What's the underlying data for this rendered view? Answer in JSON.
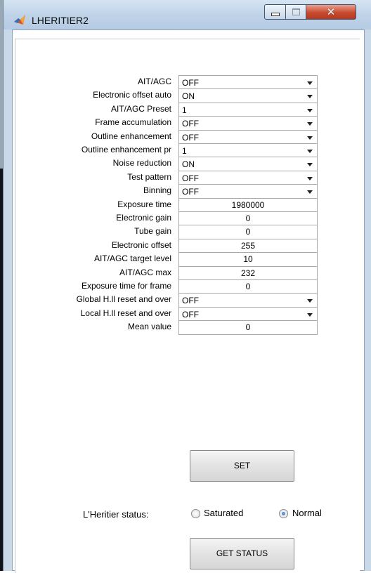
{
  "window": {
    "title": "LHERITIER2"
  },
  "params": [
    {
      "label": "AIT/AGC",
      "type": "select",
      "value": "OFF"
    },
    {
      "label": "Electronic offset auto",
      "type": "select",
      "value": "ON"
    },
    {
      "label": "AIT/AGC Preset",
      "type": "select",
      "value": "1"
    },
    {
      "label": "Frame accumulation",
      "type": "select",
      "value": "OFF"
    },
    {
      "label": "Outline enhancement",
      "type": "select",
      "value": "OFF"
    },
    {
      "label": "Outline enhancement pr",
      "type": "select",
      "value": "1"
    },
    {
      "label": "Noise reduction",
      "type": "select",
      "value": "ON"
    },
    {
      "label": "Test pattern",
      "type": "select",
      "value": "OFF"
    },
    {
      "label": "Binning",
      "type": "select",
      "value": "OFF"
    },
    {
      "label": "Exposure time",
      "type": "edit",
      "value": "1980000"
    },
    {
      "label": "Electronic gain",
      "type": "edit",
      "value": "0"
    },
    {
      "label": "Tube gain",
      "type": "edit",
      "value": "0"
    },
    {
      "label": "Electronic offset",
      "type": "edit",
      "value": "255"
    },
    {
      "label": "AIT/AGC target level",
      "type": "edit",
      "value": "10"
    },
    {
      "label": "AIT/AGC max",
      "type": "edit",
      "value": "232"
    },
    {
      "label": "Exposure time for frame",
      "type": "edit",
      "value": "0"
    },
    {
      "label": "Global H.ll reset and over",
      "type": "select",
      "value": "OFF"
    },
    {
      "label": "Local H.ll reset and over",
      "type": "select",
      "value": "OFF"
    },
    {
      "label": "Mean value",
      "type": "edit",
      "value": "0"
    }
  ],
  "set_button": "SET",
  "status": {
    "label": "L'Heritier status:",
    "options": [
      {
        "label": "Saturated",
        "checked": false
      },
      {
        "label": "Normal",
        "checked": true
      }
    ]
  },
  "get_status_button": "GET STATUS"
}
